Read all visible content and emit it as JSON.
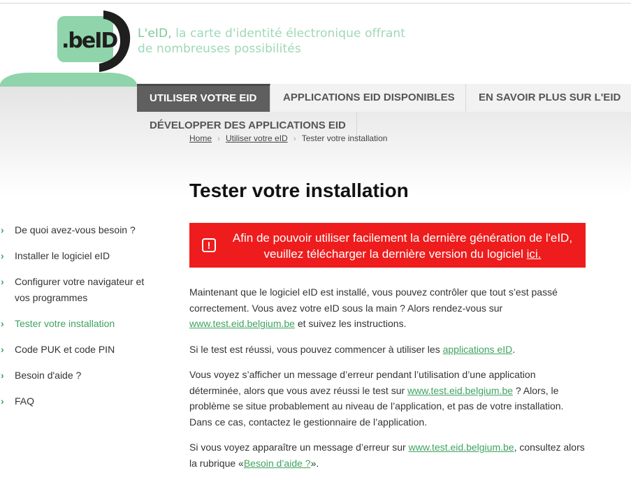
{
  "header": {
    "logo_text": ".beID",
    "tagline_strong": "L'eID,",
    "tagline_rest": "la carte d'identité électronique offrant",
    "tagline_line2": "de nombreuses possibilités"
  },
  "nav": {
    "items": [
      {
        "label": "UTILISER VOTRE EID"
      },
      {
        "label": "APPLICATIONS EID DISPONIBLES"
      },
      {
        "label": "EN SAVOIR PLUS SUR L'EID"
      },
      {
        "label": "DÉVELOPPER DES APPLICATIONS EID"
      }
    ]
  },
  "breadcrumb": {
    "home": "Home",
    "parent": "Utiliser votre eID",
    "current": "Tester votre installation"
  },
  "page": {
    "title": "Tester votre installation"
  },
  "sidebar": {
    "items": [
      {
        "label": "De quoi avez-vous besoin ?"
      },
      {
        "label": "Installer le logiciel eID"
      },
      {
        "label": "Configurer votre navigateur et vos programmes"
      },
      {
        "label": "Tester votre installation"
      },
      {
        "label": "Code PUK et code PIN"
      },
      {
        "label": "Besoin d'aide ?"
      },
      {
        "label": "FAQ"
      }
    ],
    "chevron": "›"
  },
  "alert": {
    "icon": "!",
    "text": "Afin de pouvoir utiliser facilement la dernière génération de l'eID, veuillez télécharger la dernière version du logiciel",
    "link": "ici."
  },
  "content": {
    "p1_a": "Maintenant que le logiciel eID est installé, vous pouvez contrôler que tout s’est passé correctement. Vous avez votre eID sous la main ? Alors rendez-vous sur",
    "p1_link": "www.test.eid.belgium.be",
    "p1_b": "et suivez les instructions.",
    "p2_a": "Si le test est réussi, vous pouvez commencer à utiliser les",
    "p2_link": "applications eID",
    "p2_b": ".",
    "p3_a": "Vous voyez s’afficher un message d’erreur pendant l’utilisation d’une application déterminée, alors que vous avez réussi le test sur",
    "p3_link": "www.test.eid.belgium.be",
    "p3_b": "? Alors, le problème se situe probablement au niveau de l’application, et pas de votre installation. Dans ce cas, contactez le gestionnaire de l’application.",
    "p4_a": "Si vous voyez apparaître un message d’erreur sur",
    "p4_link": "www.test.eid.belgium.be",
    "p4_b": ", consultez alors la rubrique «",
    "p4_link2": "Besoin d’aide ?",
    "p4_c": "»."
  },
  "colors": {
    "accent_green": "#3fa35f",
    "alert_red": "#ee1c1c",
    "nav_active": "#5f5f5f"
  }
}
